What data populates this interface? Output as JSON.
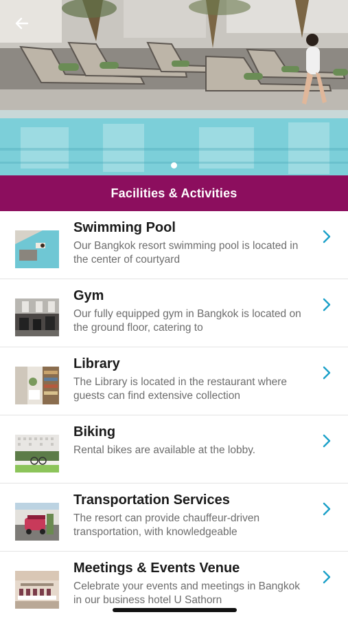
{
  "header": {
    "back_icon": "arrow-left-icon",
    "carousel": {
      "count": 1,
      "active": 0
    }
  },
  "section": {
    "title": "Facilities & Activities"
  },
  "items": [
    {
      "title": "Swimming Pool",
      "description": "Our Bangkok resort swimming pool is located in the center of courtyard",
      "thumb": "pool"
    },
    {
      "title": "Gym",
      "description": "Our fully equipped gym in Bangkok is located on the ground floor, catering to",
      "thumb": "gym"
    },
    {
      "title": "Library",
      "description": "The Library is located in the restaurant where guests can find extensive collection",
      "thumb": "library"
    },
    {
      "title": "Biking",
      "description": "Rental bikes are available at the lobby.",
      "thumb": "biking"
    },
    {
      "title": "Transportation Services",
      "description": "The resort can provide chauffeur-driven transportation, with knowledgeable",
      "thumb": "tuktuk"
    },
    {
      "title": "Meetings & Events Venue",
      "description": "Celebrate your events and meetings in Bangkok in our business hotel U Sathorn",
      "thumb": "meeting"
    }
  ],
  "colors": {
    "accent": "#8c0e5e",
    "chevron": "#1aa0c8",
    "title_text": "#1a1a1a",
    "desc_text": "#6d6d6d"
  }
}
